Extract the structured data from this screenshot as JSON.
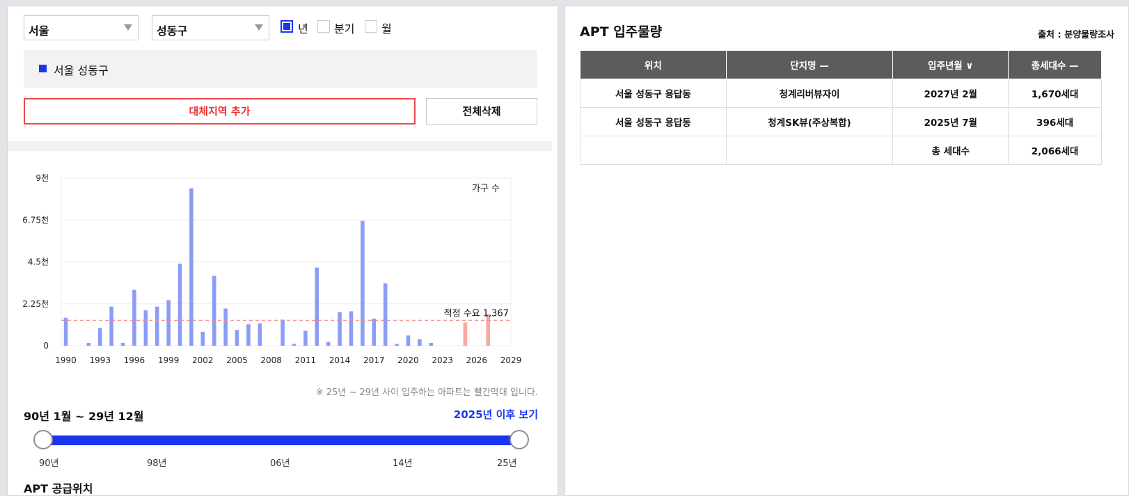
{
  "filters": {
    "region": "서울",
    "district": "성동구",
    "periods": [
      {
        "label": "년",
        "checked": true
      },
      {
        "label": "분기",
        "checked": false
      },
      {
        "label": "월",
        "checked": false
      }
    ]
  },
  "selected_region": {
    "label": "서울 성동구",
    "color": "#1a35f0"
  },
  "buttons": {
    "add_region": "대체지역 추가",
    "delete_all": "전체삭제"
  },
  "chart_data": {
    "type": "bar",
    "ylabel": "가구 수",
    "y_ticks": [
      "0",
      "2.25천",
      "4.5천",
      "6.75천",
      "9천"
    ],
    "ylim": [
      0,
      9000
    ],
    "x_ticks": [
      "1990",
      "1993",
      "1996",
      "1999",
      "2002",
      "2005",
      "2008",
      "2011",
      "2014",
      "2017",
      "2020",
      "2023",
      "2026",
      "2029"
    ],
    "x": [
      1990,
      1991,
      1992,
      1993,
      1994,
      1995,
      1996,
      1997,
      1998,
      1999,
      2000,
      2001,
      2002,
      2003,
      2004,
      2005,
      2006,
      2007,
      2008,
      2009,
      2010,
      2011,
      2012,
      2013,
      2014,
      2015,
      2016,
      2017,
      2018,
      2019,
      2020,
      2021,
      2022,
      2023,
      2024,
      2025,
      2026,
      2027,
      2028,
      2029
    ],
    "values": [
      1500,
      0,
      150,
      950,
      2100,
      150,
      3000,
      1900,
      2100,
      2450,
      4400,
      8450,
      750,
      3750,
      2000,
      850,
      1150,
      1200,
      0,
      1400,
      100,
      800,
      4200,
      200,
      1800,
      1850,
      6700,
      1450,
      3350,
      100,
      550,
      350,
      150,
      0,
      0,
      1250,
      0,
      1700,
      0,
      0
    ],
    "future_from": 2025,
    "bar_color": "#8c9cf6",
    "future_color": "#f7a9a3",
    "reference": {
      "label": "적정 수요 1,367",
      "value": 1367,
      "color": "#f08a8a"
    },
    "note": "※ 25년 ~ 29년 사이 입주하는 아파트는 빨간막대 입니다."
  },
  "range": {
    "label": "90년 1월 ~ 29년 12월",
    "link": "2025년 이후 보기",
    "ticks": [
      "90년",
      "98년",
      "06년",
      "14년",
      "25년"
    ],
    "accent": "#1a35f0"
  },
  "supply_location": {
    "title": "APT 공급위치"
  },
  "right": {
    "title": "APT 입주물량",
    "source": "출처 : 분양물량조사",
    "headers": [
      "위치",
      "단지명 —",
      "입주년월 ∨",
      "총세대수 —"
    ],
    "rows": [
      [
        "서울 성동구 용답동",
        "청계리버뷰자이",
        "2027년 2월",
        "1,670세대"
      ],
      [
        "서울 성동구 용답동",
        "청계SK뷰(주상복합)",
        "2025년 7월",
        "396세대"
      ],
      [
        "",
        "",
        "총 세대수",
        "2,066세대"
      ]
    ]
  }
}
